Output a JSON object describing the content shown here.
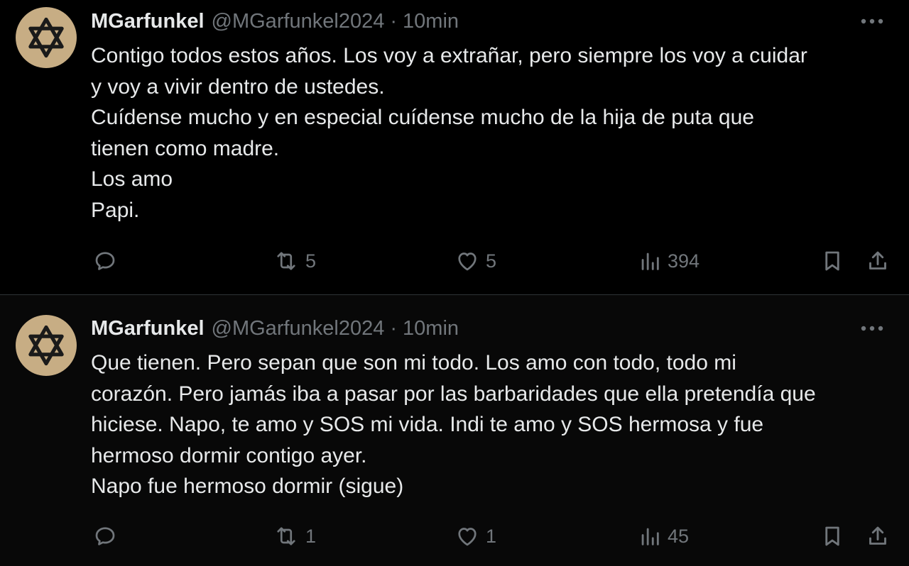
{
  "tweets": [
    {
      "display_name": "MGarfunkel",
      "handle": "@MGarfunkel2024",
      "separator": "·",
      "time": "10min",
      "avatar_icon": "star-of-david-icon",
      "lines": [
        "Contigo todos estos años. Los voy a extrañar, pero siempre los voy a cuidar",
        "y voy a vivir dentro de ustedes.",
        "Cuídense mucho y en especial cuídense mucho de la hija de puta que",
        "tienen como madre.",
        "Los amo",
        "Papi."
      ],
      "retweets": "5",
      "likes": "5",
      "views": "394"
    },
    {
      "display_name": "MGarfunkel",
      "handle": "@MGarfunkel2024",
      "separator": "·",
      "time": "10min",
      "avatar_icon": "star-of-david-icon",
      "lines": [
        "Que tienen. Pero sepan que son mi todo. Los amo con todo, todo mi",
        "corazón. Pero jamás iba a pasar por las barbaridades que ella pretendía que",
        "hiciese. Napo, te amo y SOS mi vida. Indi te amo y SOS hermosa y fue",
        "hermoso dormir contigo ayer.",
        "Napo fue hermoso dormir (sigue)"
      ],
      "retweets": "1",
      "likes": "1",
      "views": "45"
    }
  ],
  "colors": {
    "background": "#000000",
    "text": "#e7e9ea",
    "muted": "#71767b",
    "avatar_bg": "#c7ad84",
    "divider": "#2f3336"
  }
}
